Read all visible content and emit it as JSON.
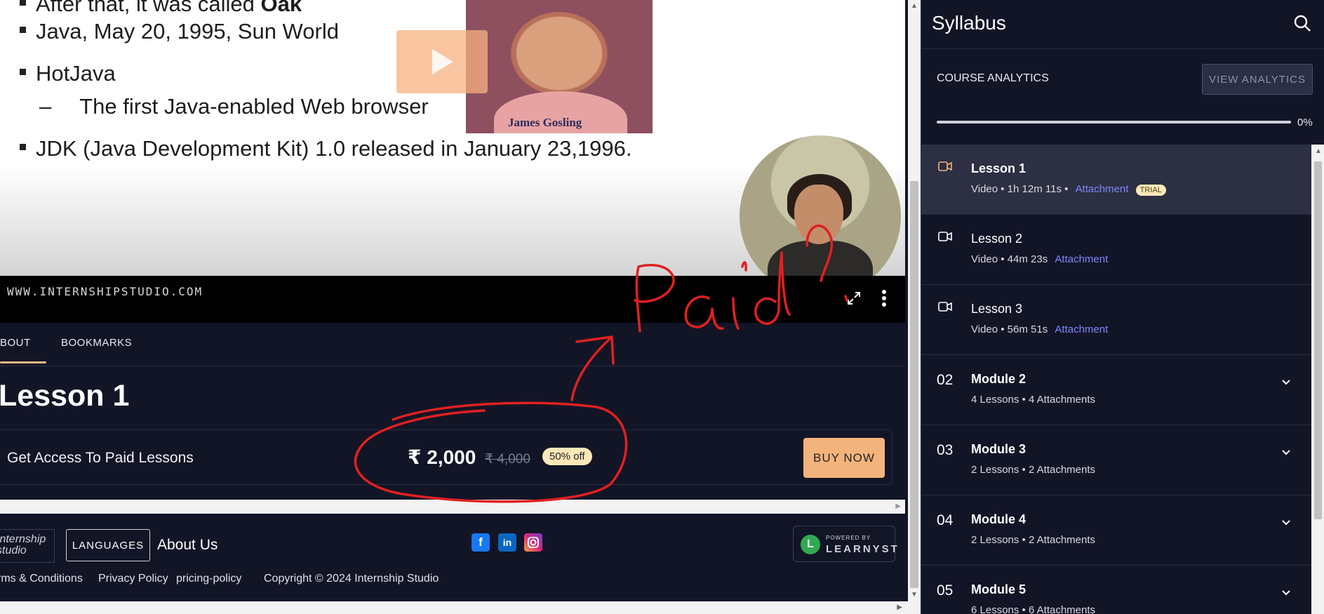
{
  "player": {
    "slide_lines": {
      "line1_text": "After that, it was called",
      "line1_bold": "Oak",
      "line2": "Java, May 20, 1995, Sun World",
      "line3": "HotJava",
      "line4_dash": "–",
      "line4": "The first Java-enabled Web browser",
      "line5": "JDK (Java Development Kit) 1.0 released in January 23,1996."
    },
    "photo_caption": "James Gosling",
    "watermark": "WWW.INTERNSHIPSTUDIO.COM",
    "play_icon": "play-icon",
    "fullscreen_icon": "fullscreen-icon",
    "more_icon": "more-vertical-icon"
  },
  "tabs": [
    {
      "label": "BOUT"
    },
    {
      "label": "BOOKMARKS"
    }
  ],
  "lesson": {
    "title": "Lesson 1"
  },
  "purchase": {
    "text": "Get Access To Paid Lessons",
    "price": "₹ 2,000",
    "old_price": "₹ 4,000",
    "discount": "50% off",
    "button": "BUY NOW"
  },
  "footer": {
    "logo_text": "Internship studio",
    "languages_button": "LANGUAGES",
    "about_us": "About Us",
    "social": [
      "facebook-icon",
      "linkedin-icon",
      "instagram-icon"
    ],
    "powered_by": "POWERED BY",
    "brand": "LEARNYST",
    "links": [
      "rms & Conditions",
      "Privacy Policy",
      "pricing-policy"
    ],
    "copyright": "Copyright © 2024 Internship Studio"
  },
  "sidebar": {
    "title": "Syllabus",
    "search_icon": "search-icon",
    "analytics_label": "COURSE ANALYTICS",
    "analytics_button": "VIEW ANALYTICS",
    "progress_percent": "0%",
    "progress_value": 0,
    "lessons": [
      {
        "title": "Lesson 1",
        "meta": "Video • 1h 12m 11s •",
        "attachment": "Attachment",
        "badge": "TRIAL"
      },
      {
        "title": "Lesson 2",
        "meta": "Video • 44m 23s",
        "attachment": "Attachment"
      },
      {
        "title": "Lesson 3",
        "meta": "Video • 56m 51s",
        "attachment": "Attachment"
      }
    ],
    "modules": [
      {
        "num": "02",
        "title": "Module 2",
        "meta": "4 Lessons • 4 Attachments"
      },
      {
        "num": "03",
        "title": "Module 3",
        "meta": "2 Lessons • 2 Attachments"
      },
      {
        "num": "04",
        "title": "Module 4",
        "meta": "2 Lessons • 2 Attachments"
      },
      {
        "num": "05",
        "title": "Module 5",
        "meta": "6 Lessons • 6 Attachments"
      }
    ]
  },
  "annotation": {
    "handwritten_text": "Paid",
    "color": "#e02020"
  },
  "colors": {
    "accent": "#f3b37c",
    "background": "#121526",
    "link": "#7f86ff"
  }
}
